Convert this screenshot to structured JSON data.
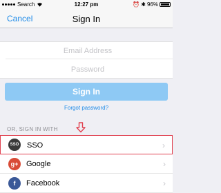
{
  "status_bar": {
    "carrier": "Search",
    "time": "12:27 pm",
    "battery": "96%"
  },
  "nav": {
    "cancel_label": "Cancel",
    "title": "Sign In"
  },
  "form": {
    "email_placeholder": "Email Address",
    "password_placeholder": "Password",
    "signin_label": "Sign In",
    "forgot_label": "Forgot password?"
  },
  "alt_signin": {
    "header": "OR, SIGN IN WITH",
    "providers": [
      {
        "label": "SSO",
        "icon": "sso-icon",
        "icon_text": "SSO"
      },
      {
        "label": "Google",
        "icon": "google-plus-icon",
        "icon_text": "g+"
      },
      {
        "label": "Facebook",
        "icon": "facebook-icon",
        "icon_text": "f"
      }
    ]
  },
  "colors": {
    "accent": "#1e8be8",
    "signin_button": "#8ec9f4",
    "highlight_border": "#e0404f"
  }
}
